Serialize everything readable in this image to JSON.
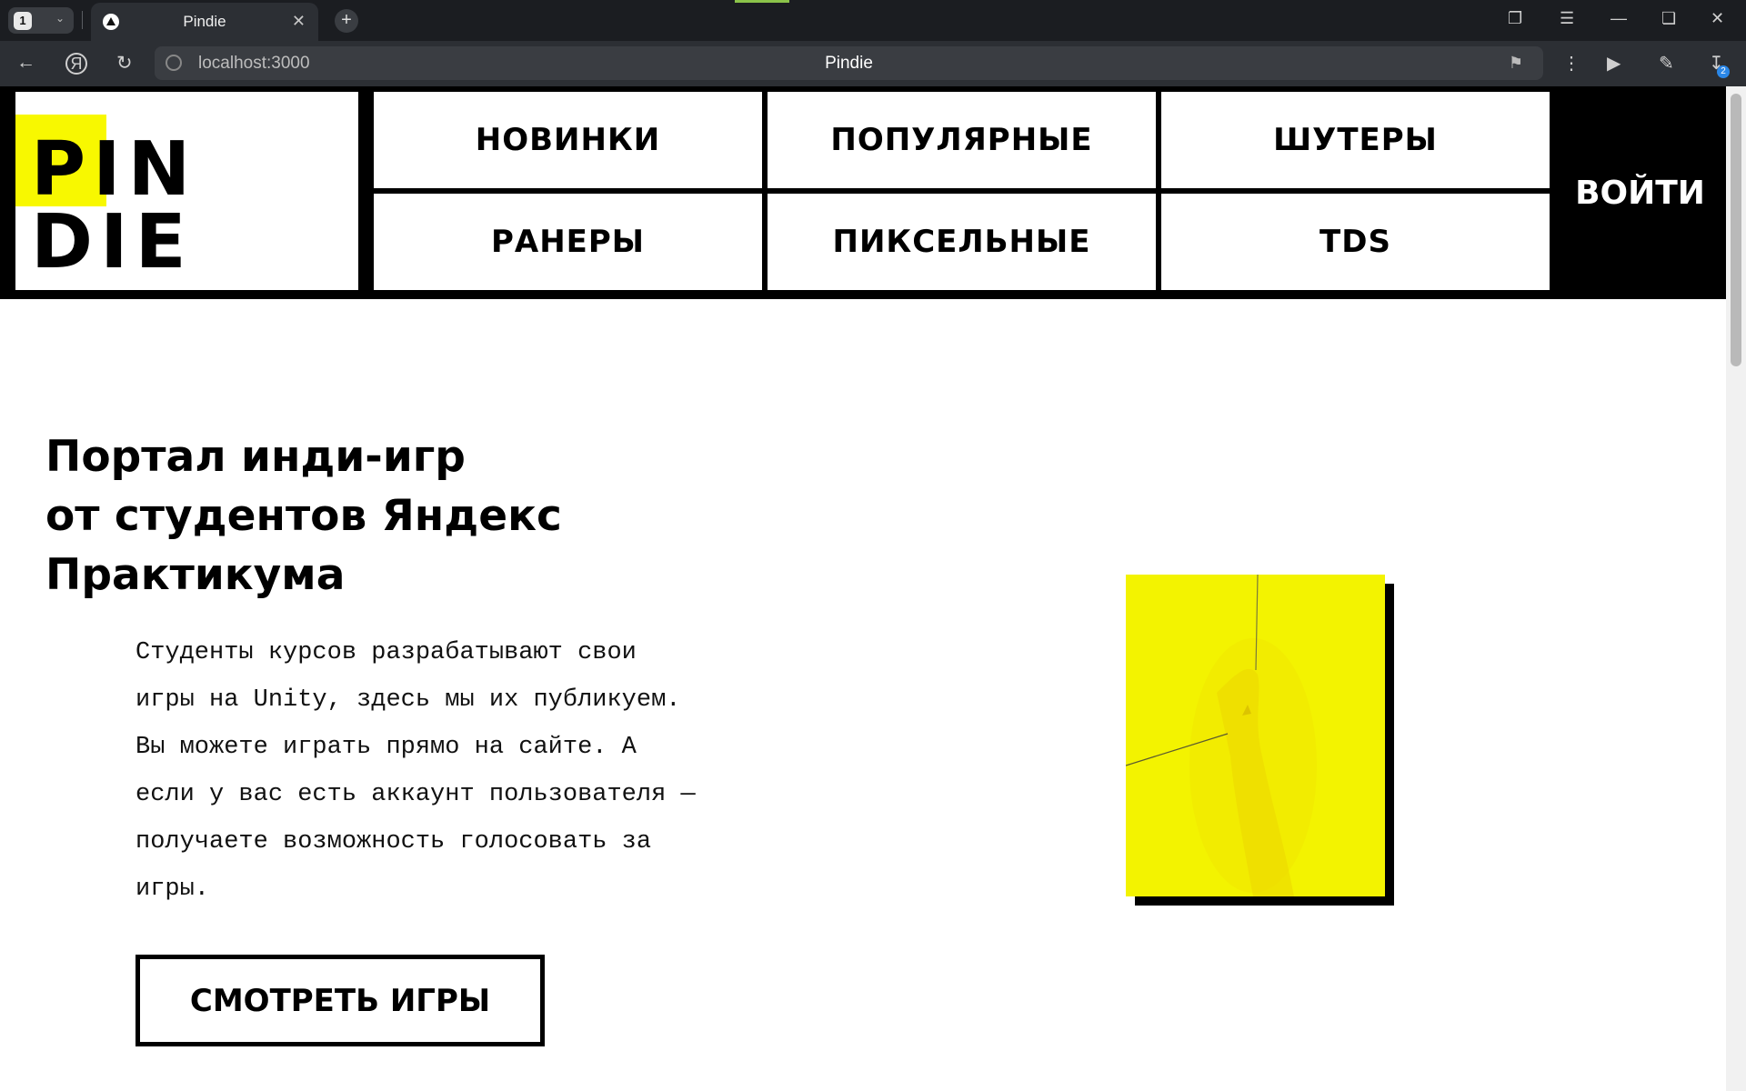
{
  "browser": {
    "tab_count": "1",
    "tab_title": "Pindie",
    "url": "localhost:3000",
    "page_title": "Pindie",
    "downloads_badge": "2"
  },
  "site": {
    "logo": {
      "line1": "PIN",
      "line2": "DIE"
    },
    "nav": [
      {
        "label": "НОВИНКИ"
      },
      {
        "label": "ПОПУЛЯРНЫЕ"
      },
      {
        "label": "ШУТЕРЫ"
      },
      {
        "label": "РАНЕРЫ"
      },
      {
        "label": "ПИКСЕЛЬНЫЕ"
      },
      {
        "label": "TDS"
      }
    ],
    "login_label": "ВОЙТИ"
  },
  "hero": {
    "title_lines": [
      "Портал инди-игр",
      "от студентов Яндекс",
      "Практикума"
    ],
    "text_lines": [
      "Студенты курсов разрабатывают свои",
      "игры на Unity, здесь мы их публикуем.",
      "Вы можете играть прямо на сайте. А",
      "если у вас есть аккаунт пользователя —",
      "получаете возможность голосовать за",
      "игры."
    ],
    "cta_label": "СМОТРЕТЬ ИГРЫ"
  },
  "colors": {
    "accent_yellow": "#f8f800",
    "black": "#000000",
    "chrome_bg": "#1b1d21"
  }
}
